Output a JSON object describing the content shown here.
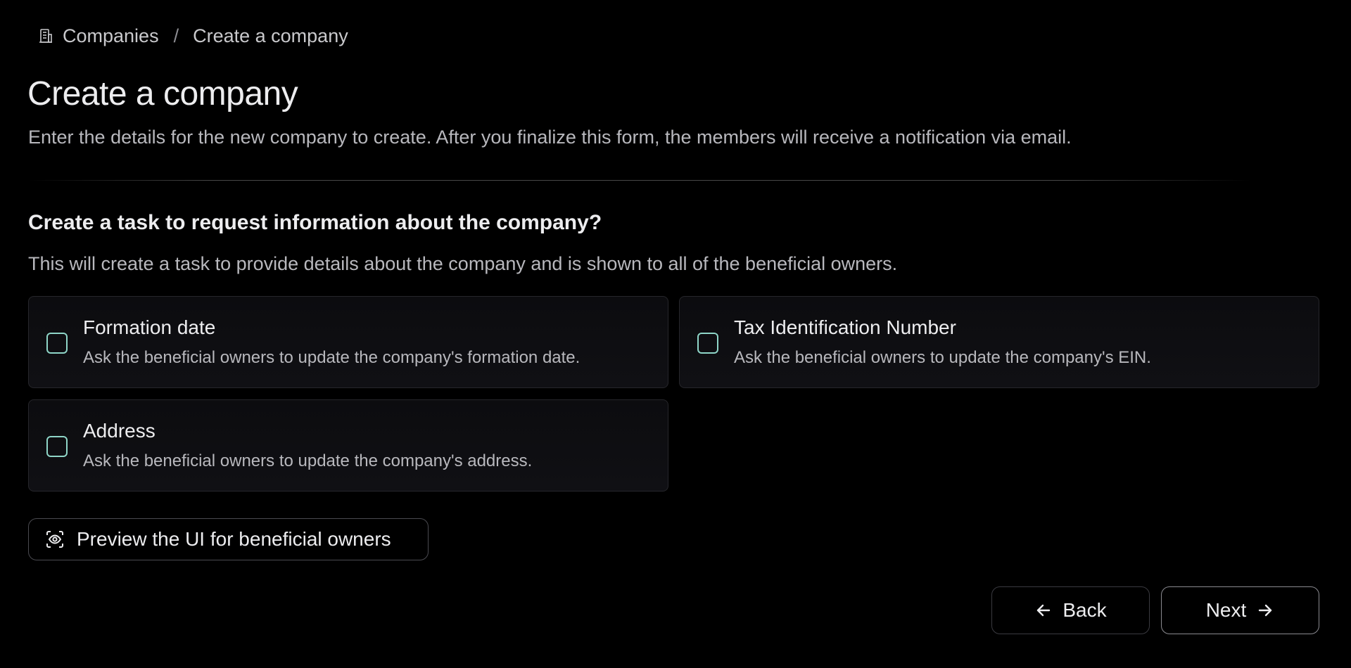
{
  "breadcrumb": {
    "icon": "building-icon",
    "root": "Companies",
    "separator": "/",
    "current": "Create a company"
  },
  "header": {
    "title": "Create a company",
    "description": "Enter the details for the new company to create. After you finalize this form, the members will receive a notification via email."
  },
  "section": {
    "title": "Create a task to request information about the company?",
    "description": "This will create a task to provide details about the company and is shown to all of the beneficial owners."
  },
  "options": [
    {
      "title": "Formation date",
      "description": "Ask the beneficial owners to update the company's formation date.",
      "checked": false
    },
    {
      "title": "Tax Identification Number",
      "description": "Ask the beneficial owners to update the company's EIN.",
      "checked": false
    },
    {
      "title": "Address",
      "description": "Ask the beneficial owners to update the company's address.",
      "checked": false
    }
  ],
  "preview_button": {
    "label": "Preview the UI for beneficial owners",
    "icon": "eye-icon"
  },
  "footer": {
    "back_label": "Back",
    "back_icon": "arrow-left-icon",
    "next_label": "Next",
    "next_icon": "arrow-right-icon"
  },
  "colors": {
    "background": "#000000",
    "checkbox_border": "#8fd6c8",
    "text_primary": "#ededef",
    "text_secondary": "#b8b8bd"
  }
}
